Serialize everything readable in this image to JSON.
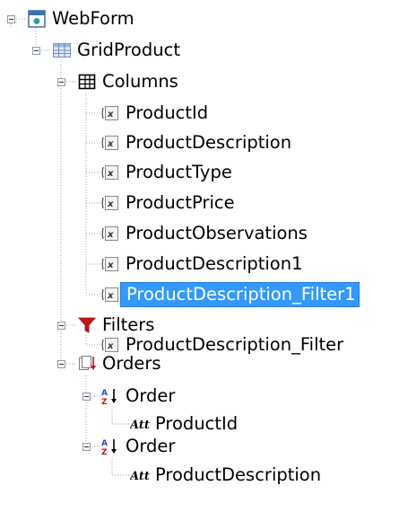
{
  "tree": {
    "root": {
      "label": "WebForm",
      "icon": "webform-icon"
    },
    "grid": {
      "label": "GridProduct",
      "icon": "grid-icon"
    },
    "columns": {
      "label": "Columns",
      "icon": "columns-table-icon",
      "items": [
        {
          "label": "ProductId",
          "icon": "attribute-variable-icon"
        },
        {
          "label": "ProductDescription",
          "icon": "attribute-variable-icon"
        },
        {
          "label": "ProductType",
          "icon": "attribute-variable-icon"
        },
        {
          "label": "ProductPrice",
          "icon": "attribute-variable-icon"
        },
        {
          "label": "ProductObservations",
          "icon": "attribute-variable-icon"
        },
        {
          "label": "ProductDescription1",
          "icon": "attribute-variable-icon"
        },
        {
          "label": "ProductDescription_Filter1",
          "icon": "attribute-variable-icon",
          "selected": true
        }
      ]
    },
    "filters": {
      "label": "Filters",
      "icon": "filter-funnel-icon",
      "items": [
        {
          "label": "ProductDescription_Filter",
          "icon": "attribute-variable-icon"
        }
      ]
    },
    "orders": {
      "label": "Orders",
      "icon": "orders-sort-icon",
      "items": [
        {
          "label": "Order",
          "icon": "sort-az-icon",
          "attribute": {
            "label": "ProductId",
            "icon": "attribute-att-icon"
          }
        },
        {
          "label": "Order",
          "icon": "sort-az-icon",
          "attribute": {
            "label": "ProductDescription",
            "icon": "attribute-att-icon"
          }
        }
      ]
    }
  },
  "colors": {
    "selection": "#3399ff",
    "selection_text": "#ffffff",
    "tree_lines": "#a0a0a0",
    "filter_red": "#cc1111",
    "sort_blue": "#1f4fbf",
    "sort_red": "#cc1111"
  }
}
